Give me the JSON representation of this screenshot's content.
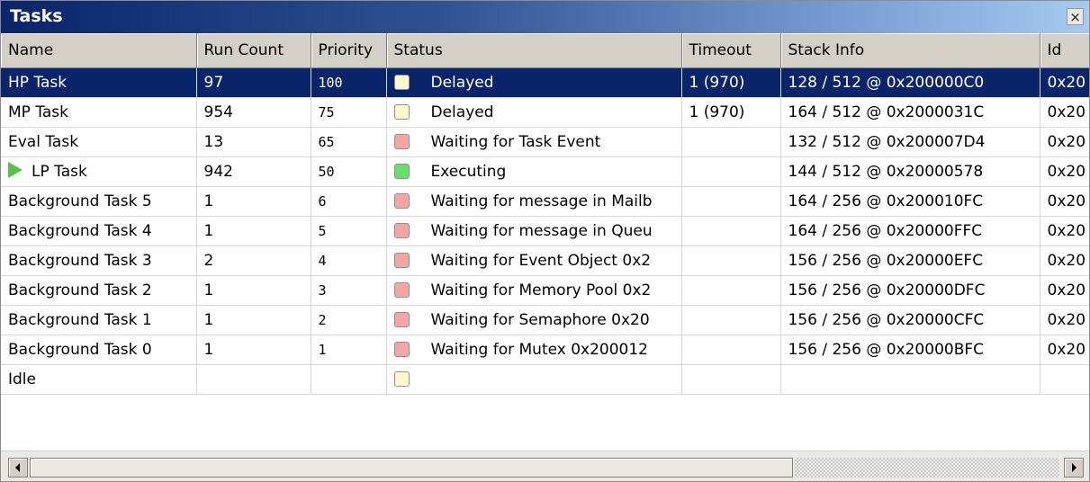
{
  "window": {
    "title": "Tasks",
    "close_icon": "close-icon"
  },
  "columns": [
    "Name",
    "Run Count",
    "Priority",
    "Status",
    "Timeout",
    "Stack Info",
    "Id"
  ],
  "status_colors": {
    "delayed": "#fff8cc",
    "waiting": "#f4a6a6",
    "executing": "#66e066"
  },
  "rows": [
    {
      "name": "HP Task",
      "run_count": "97",
      "priority": "100",
      "status": "Delayed",
      "status_color": "#fff8cc",
      "timeout": "1 (970)",
      "stack": "128 / 512 @ 0x200000C0",
      "id": "0x20",
      "selected": true,
      "executing": false
    },
    {
      "name": "MP Task",
      "run_count": "954",
      "priority": "75",
      "status": "Delayed",
      "status_color": "#fff8cc",
      "timeout": "1 (970)",
      "stack": "164 / 512 @ 0x2000031C",
      "id": "0x20",
      "selected": false,
      "executing": false
    },
    {
      "name": "Eval Task",
      "run_count": "13",
      "priority": "65",
      "status": "Waiting for Task Event",
      "status_color": "#f4a6a6",
      "timeout": "",
      "stack": "132 / 512 @ 0x200007D4",
      "id": "0x20",
      "selected": false,
      "executing": false
    },
    {
      "name": "LP Task",
      "run_count": "942",
      "priority": "50",
      "status": "Executing",
      "status_color": "#66e066",
      "timeout": "",
      "stack": "144 / 512 @ 0x20000578",
      "id": "0x20",
      "selected": false,
      "executing": true
    },
    {
      "name": "Background Task 5",
      "run_count": "1",
      "priority": "6",
      "status": "Waiting for message in Mailb",
      "status_color": "#f4a6a6",
      "timeout": "",
      "stack": "164 / 256 @ 0x200010FC",
      "id": "0x20",
      "selected": false,
      "executing": false
    },
    {
      "name": "Background Task 4",
      "run_count": "1",
      "priority": "5",
      "status": "Waiting for message in Queu",
      "status_color": "#f4a6a6",
      "timeout": "",
      "stack": "164 / 256 @ 0x20000FFC",
      "id": "0x20",
      "selected": false,
      "executing": false
    },
    {
      "name": "Background Task 3",
      "run_count": "2",
      "priority": "4",
      "status": "Waiting for Event Object 0x2",
      "status_color": "#f4a6a6",
      "timeout": "",
      "stack": "156 / 256 @ 0x20000EFC",
      "id": "0x20",
      "selected": false,
      "executing": false
    },
    {
      "name": "Background Task 2",
      "run_count": "1",
      "priority": "3",
      "status": "Waiting for Memory Pool 0x2",
      "status_color": "#f4a6a6",
      "timeout": "",
      "stack": "156 / 256 @ 0x20000DFC",
      "id": "0x20",
      "selected": false,
      "executing": false
    },
    {
      "name": "Background Task 1",
      "run_count": "1",
      "priority": "2",
      "status": "Waiting for Semaphore 0x20",
      "status_color": "#f4a6a6",
      "timeout": "",
      "stack": "156 / 256 @ 0x20000CFC",
      "id": "0x20",
      "selected": false,
      "executing": false
    },
    {
      "name": "Background Task 0",
      "run_count": "1",
      "priority": "1",
      "status": "Waiting for Mutex 0x200012",
      "status_color": "#f4a6a6",
      "timeout": "",
      "stack": "156 / 256 @ 0x20000BFC",
      "id": "0x20",
      "selected": false,
      "executing": false
    },
    {
      "name": "Idle",
      "run_count": "",
      "priority": "",
      "status": "",
      "status_color": "#fff8cc",
      "timeout": "",
      "stack": "",
      "id": "",
      "selected": false,
      "executing": false
    }
  ],
  "scrollbar": {
    "left_icon": "arrow-left-icon",
    "right_icon": "arrow-right-icon"
  }
}
